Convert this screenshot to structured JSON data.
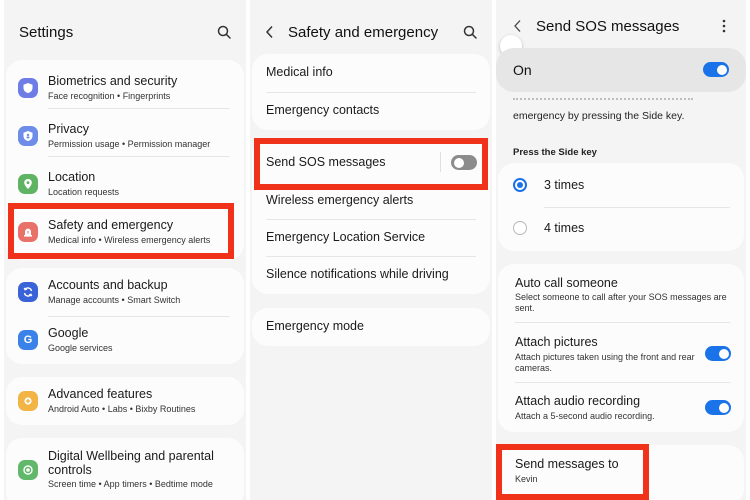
{
  "colors": {
    "accent": "#1a73e8",
    "highlight": "#f0321a",
    "panel_bg": "#f4f4f4",
    "card_bg": "#fcfcfc"
  },
  "panel1": {
    "title": "Settings",
    "search_icon": "search-icon",
    "items": [
      {
        "title": "Biometrics and security",
        "subtitle": "Face recognition  •  Fingerprints",
        "icon": "shield-icon",
        "icon_color": "#6e7ce6"
      },
      {
        "title": "Privacy",
        "subtitle": "Permission usage  •  Permission manager",
        "icon": "privacy-shield-icon",
        "icon_color": "#6d8de8"
      },
      {
        "title": "Location",
        "subtitle": "Location requests",
        "icon": "location-pin-icon",
        "icon_color": "#5fb463"
      },
      {
        "title": "Safety and emergency",
        "subtitle": "Medical info  •  Wireless emergency alerts",
        "icon": "siren-icon",
        "icon_color": "#e8716a",
        "highlighted": true
      },
      {
        "title": "Accounts and backup",
        "subtitle": "Manage accounts  •  Smart Switch",
        "icon": "sync-icon",
        "icon_color": "#3b63d8"
      },
      {
        "title": "Google",
        "subtitle": "Google services",
        "icon": "google-icon",
        "icon_color": "#3b82e8"
      },
      {
        "title": "Advanced features",
        "subtitle": "Android Auto  •  Labs  •  Bixby Routines",
        "icon": "gear-plus-icon",
        "icon_color": "#f1b445"
      },
      {
        "title": "Digital Wellbeing and parental controls",
        "subtitle": "Screen time  •  App timers  •  Bedtime mode",
        "icon": "wellbeing-icon",
        "icon_color": "#62b86a"
      }
    ]
  },
  "panel2": {
    "title": "Safety and emergency",
    "back_icon": "chevron-left-icon",
    "search_icon": "search-icon",
    "items": [
      {
        "label": "Medical info"
      },
      {
        "label": "Emergency contacts"
      },
      {
        "label": "Send SOS messages",
        "toggle": "off",
        "highlighted": true
      },
      {
        "label": "Wireless emergency alerts"
      },
      {
        "label": "Emergency Location Service"
      },
      {
        "label": "Silence notifications while driving"
      },
      {
        "label": "Emergency mode"
      }
    ]
  },
  "panel3": {
    "title": "Send SOS messages",
    "back_icon": "chevron-left-icon",
    "more_icon": "more-vertical-icon",
    "master_switch": {
      "label": "On",
      "state": "on"
    },
    "description": "emergency by pressing the Side key.",
    "press_side_key_header": "Press the Side key",
    "press_options": [
      {
        "label": "3 times",
        "selected": true
      },
      {
        "label": "4 times",
        "selected": false
      }
    ],
    "auto_call": {
      "title": "Auto call someone",
      "subtitle": "Select someone to call after your SOS messages are sent."
    },
    "attach_pictures": {
      "title": "Attach pictures",
      "subtitle": "Attach pictures taken using the front and rear cameras.",
      "state": "on"
    },
    "attach_audio": {
      "title": "Attach audio recording",
      "subtitle": "Attach a 5-second audio recording.",
      "state": "on"
    },
    "send_to": {
      "title": "Send messages to",
      "value": "Kevin",
      "highlighted": true
    }
  }
}
